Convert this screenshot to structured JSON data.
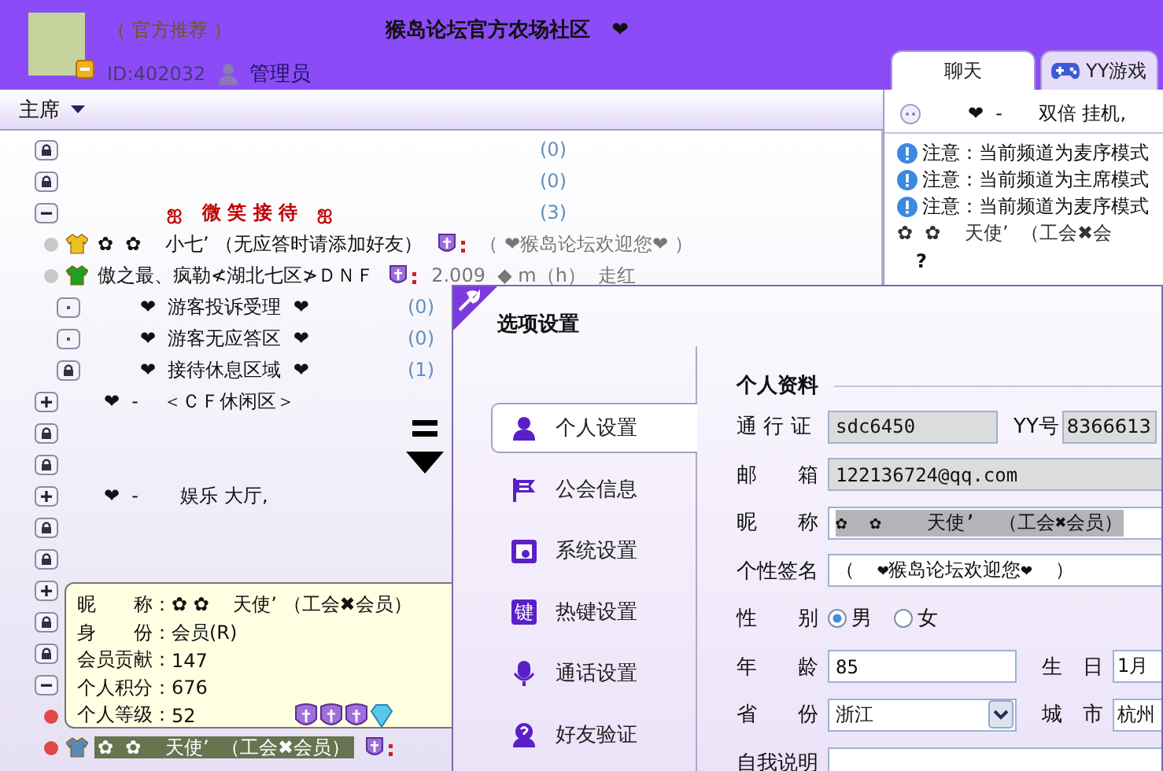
{
  "header": {
    "user": {
      "name": "（ 官方推荐 ）",
      "id": "ID:402032",
      "role": "管理员"
    },
    "title": "猴岛论坛官方农场社区   ❤"
  },
  "tabs": [
    {
      "label": "聊天",
      "selected": true
    },
    {
      "label": "YY游戏",
      "selected": false
    }
  ],
  "toolbar": {
    "mode": "主席"
  },
  "tree": [
    {
      "kind": "locked",
      "count": "(0)"
    },
    {
      "kind": "locked",
      "count": "(0)"
    },
    {
      "kind": "group",
      "expanded": true,
      "name": "ஐ   微 笑 接 待   ஐ",
      "color": "#c00000",
      "count": "(3)",
      "children": [
        {
          "kind": "user",
          "color": "#c8c8c8",
          "name": "✿  ✿    小七’ （无应答时请添加好友）",
          "badge": true,
          "sig": "（ ❤猴岛论坛欢迎您❤ ）",
          "selected": false
        },
        {
          "kind": "user",
          "color": "#c8c8c8",
          "name": "傲之最、疯勒≮湖北七区≯ＤＮＦ",
          "badge": true,
          "sig": "2.009  ◆ m（h）  走红",
          "selected": false
        },
        {
          "kind": "room",
          "name": "❤  游客投诉受理  ❤",
          "count": "(0)"
        },
        {
          "kind": "room",
          "name": "❤  游客无应答区  ❤",
          "count": "(0)"
        },
        {
          "kind": "locked",
          "name": "❤  接待休息区域  ❤",
          "count": "(1)"
        }
      ]
    },
    {
      "kind": "group",
      "expanded": false,
      "name": "❤  -    ＜ＣＦ休闲区＞"
    },
    {
      "kind": "locked"
    },
    {
      "kind": "locked"
    },
    {
      "kind": "group",
      "expanded": false,
      "name": "❤  -       娱乐 大厅,"
    },
    {
      "kind": "locked"
    },
    {
      "kind": "locked"
    },
    {
      "kind": "group",
      "expanded": false
    },
    {
      "kind": "locked"
    },
    {
      "kind": "locked"
    },
    {
      "kind": "group",
      "expanded": true,
      "children": [
        {
          "kind": "user",
          "color": "#e04848"
        },
        {
          "kind": "user",
          "color": "#e04848",
          "name": "✿  ✿    天使’  （工会✖会员）",
          "badge": true,
          "selected": true
        }
      ]
    }
  ],
  "tooltip": {
    "rows": [
      {
        "label": "昵　　称：",
        "value": "✿ ✿    天使’ （工会✖会员）"
      },
      {
        "label": "身　　份：",
        "value": "会员(R)"
      },
      {
        "label": "会员贡献：",
        "value": "147"
      },
      {
        "label": "个人积分：",
        "value": "676"
      },
      {
        "label": "个人等级：",
        "value": "52"
      }
    ],
    "medals": [
      {
        "kind": "shield"
      },
      {
        "kind": "shield"
      },
      {
        "kind": "shield"
      },
      {
        "kind": "diamond"
      }
    ]
  },
  "chat": [
    {
      "kind": "channel",
      "text": "❤  -      双倍 挂机,"
    },
    {
      "kind": "notice",
      "text": "注意：当前频道为麦序模式"
    },
    {
      "kind": "notice",
      "text": "注意：当前频道为主席模式"
    },
    {
      "kind": "notice",
      "text": "注意：当前频道为麦序模式"
    },
    {
      "kind": "plain",
      "text": "✿  ✿    天使’  （工会✖会"
    },
    {
      "kind": "mark",
      "text": "?"
    }
  ],
  "dialog": {
    "title": "选项设置",
    "nav": [
      {
        "label": "个人设置",
        "selected": true
      },
      {
        "label": "公会信息",
        "selected": false
      },
      {
        "label": "系统设置",
        "selected": false
      },
      {
        "label": "热键设置",
        "icon_text": "键",
        "selected": false
      },
      {
        "label": "通话设置",
        "selected": false
      },
      {
        "label": "好友验证",
        "selected": false
      }
    ],
    "section": "个人资料",
    "rows": [
      {
        "fields": [
          {
            "label": "通 行 证",
            "kind": "readonly",
            "value": "sdc6450"
          },
          {
            "label": "YY号",
            "kind": "readonly",
            "value": "8366613"
          }
        ]
      },
      {
        "fields": [
          {
            "label": "邮　　箱",
            "kind": "readonly",
            "value": "122136724@qq.com"
          }
        ]
      },
      {
        "fields": [
          {
            "label": "昵　　称",
            "kind": "text",
            "value": "✿  ✿    天使’  （工会✖会员）",
            "highlighted": true
          }
        ]
      },
      {
        "fields": [
          {
            "label": "个性签名",
            "kind": "text",
            "value": "（  ❤猴岛论坛欢迎您❤  ）",
            "highlighted": false
          }
        ]
      },
      {
        "fields": [
          {
            "label": "性　　别",
            "kind": "radio",
            "options": [
              {
                "label": "男",
                "selected": true
              },
              {
                "label": "女",
                "selected": false
              }
            ]
          }
        ]
      },
      {
        "fields": [
          {
            "label": "年　　龄",
            "kind": "text",
            "value": "85",
            "highlighted": false
          },
          {
            "label": "生　日",
            "kind": "text",
            "value": "1月",
            "highlighted": false
          }
        ]
      },
      {
        "fields": [
          {
            "label": "省　　份",
            "kind": "select",
            "value": "浙江"
          },
          {
            "label": "城　市",
            "kind": "text",
            "value": "杭州",
            "highlighted": false
          }
        ]
      },
      {
        "fields": [
          {
            "label": "自我说明",
            "kind": "textarea"
          }
        ]
      }
    ]
  }
}
